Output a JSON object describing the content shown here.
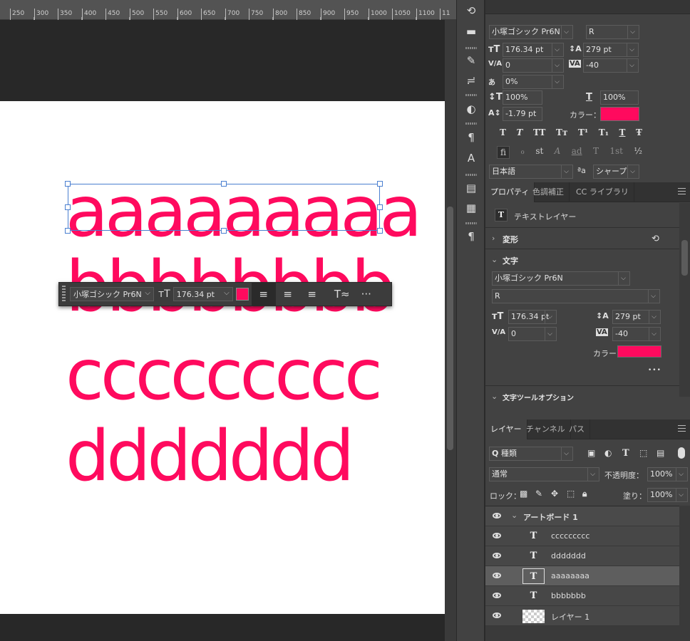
{
  "ruler": {
    "ticks": [
      "250",
      "300",
      "350",
      "400",
      "450",
      "500",
      "550",
      "600",
      "650",
      "700",
      "750",
      "800",
      "850",
      "900",
      "950",
      "1000",
      "1050",
      "1100",
      "11"
    ]
  },
  "canvas": {
    "lines": [
      "aaaaaaaaa",
      "bbbbbbbb",
      "ccccccccc",
      "ddddddd"
    ],
    "text_color": "#ff0a5e"
  },
  "float_toolbar": {
    "font": "小塚ゴシック Pr6N",
    "size": "176.34 pt",
    "color": "#ff0a5e",
    "align_left": "≡",
    "align_center": "≡",
    "align_right": "≡",
    "more": "···"
  },
  "character": {
    "font_family": "小塚ゴシック Pr6N",
    "font_style": "R",
    "size": "176.34 pt",
    "leading": "279 pt",
    "kerning": "0",
    "tracking": "-40",
    "tsume": "0%",
    "vscale": "100%",
    "hscale": "100%",
    "baseline": "-1.79 pt",
    "color_label": "カラー：",
    "language": "日本語",
    "aa_label": "ªa",
    "antialias": "シャープ",
    "style_buttons": [
      "T",
      "T",
      "TT",
      "Tт",
      "T¹",
      "T₁",
      "T",
      "Ŧ"
    ],
    "opentype_buttons": [
      "fi",
      "ℴ",
      "st",
      "A",
      "ad",
      "T",
      "1st",
      "½"
    ]
  },
  "properties": {
    "tabs": [
      "プロパティ",
      "色調補正",
      "CC ライブラリ"
    ],
    "layer_type": "テキストレイヤー",
    "transform_label": "変形",
    "text_label": "文字",
    "font_family": "小塚ゴシック Pr6N",
    "font_style": "R",
    "size": "176.34 pt",
    "leading": "279 pt",
    "kerning": "0",
    "tracking": "-40",
    "color_label": "カラー",
    "more": "•••",
    "text_options_label": "文字ツールオプション"
  },
  "layers_panel": {
    "tabs": [
      "レイヤー",
      "チャンネル",
      "パス"
    ],
    "filter_kind": "種類",
    "blend_mode": "通常",
    "opacity_label": "不透明度：",
    "opacity": "100%",
    "lock_label": "ロック：",
    "fill_label": "塗り：",
    "fill": "100%",
    "artboard": "アートボード 1",
    "layers": [
      {
        "name": "ccccccccc",
        "type": "T"
      },
      {
        "name": "ddddddd",
        "type": "T"
      },
      {
        "name": "aaaaaaaa",
        "type": "T"
      },
      {
        "name": "bbbbbbb",
        "type": "T"
      },
      {
        "name": "レイヤー 1",
        "type": "raster"
      }
    ]
  }
}
